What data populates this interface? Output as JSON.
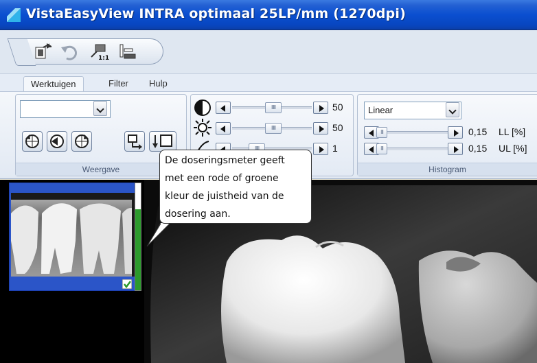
{
  "window": {
    "title": "VistaEasyView  INTRA optimaal 25LP/mm (1270dpi)",
    "icon": "app-logo-icon"
  },
  "quick_toolbar": {
    "icons": [
      "export-icon",
      "undo-icon",
      "scale-1to1-icon",
      "measure-icon"
    ]
  },
  "menu": {
    "tabs": [
      "Werktuigen",
      "Filter",
      "Hulp"
    ],
    "active_tab": "Werktuigen"
  },
  "weergave": {
    "label": "Weergave",
    "combo_value": "",
    "buttons": [
      "rotate-left-icon",
      "rotate-180-icon",
      "rotate-right-icon",
      "flip-horizontal-icon",
      "flip-vertical-icon"
    ]
  },
  "adjust": {
    "rows": [
      {
        "icon": "contrast-icon",
        "value": "50"
      },
      {
        "icon": "brightness-icon",
        "value": "50"
      },
      {
        "icon": "gamma-icon",
        "value": "1"
      }
    ]
  },
  "histogram": {
    "label": "Histogram",
    "mode": "Linear",
    "rows": [
      {
        "value": "0,15",
        "label": "LL [%]"
      },
      {
        "value": "0,15",
        "label": "UL [%]"
      }
    ]
  },
  "tooltip": {
    "lines": [
      "De doseringsmeter geeft",
      "met een rode of groene",
      "kleur de juistheid van de",
      "dosering aan."
    ]
  },
  "thumbnail": {
    "checked": true,
    "dose_status_color": "#2b9a2b"
  },
  "colors": {
    "titlebar": "#0a4fd0",
    "accent": "#2b55c8"
  }
}
